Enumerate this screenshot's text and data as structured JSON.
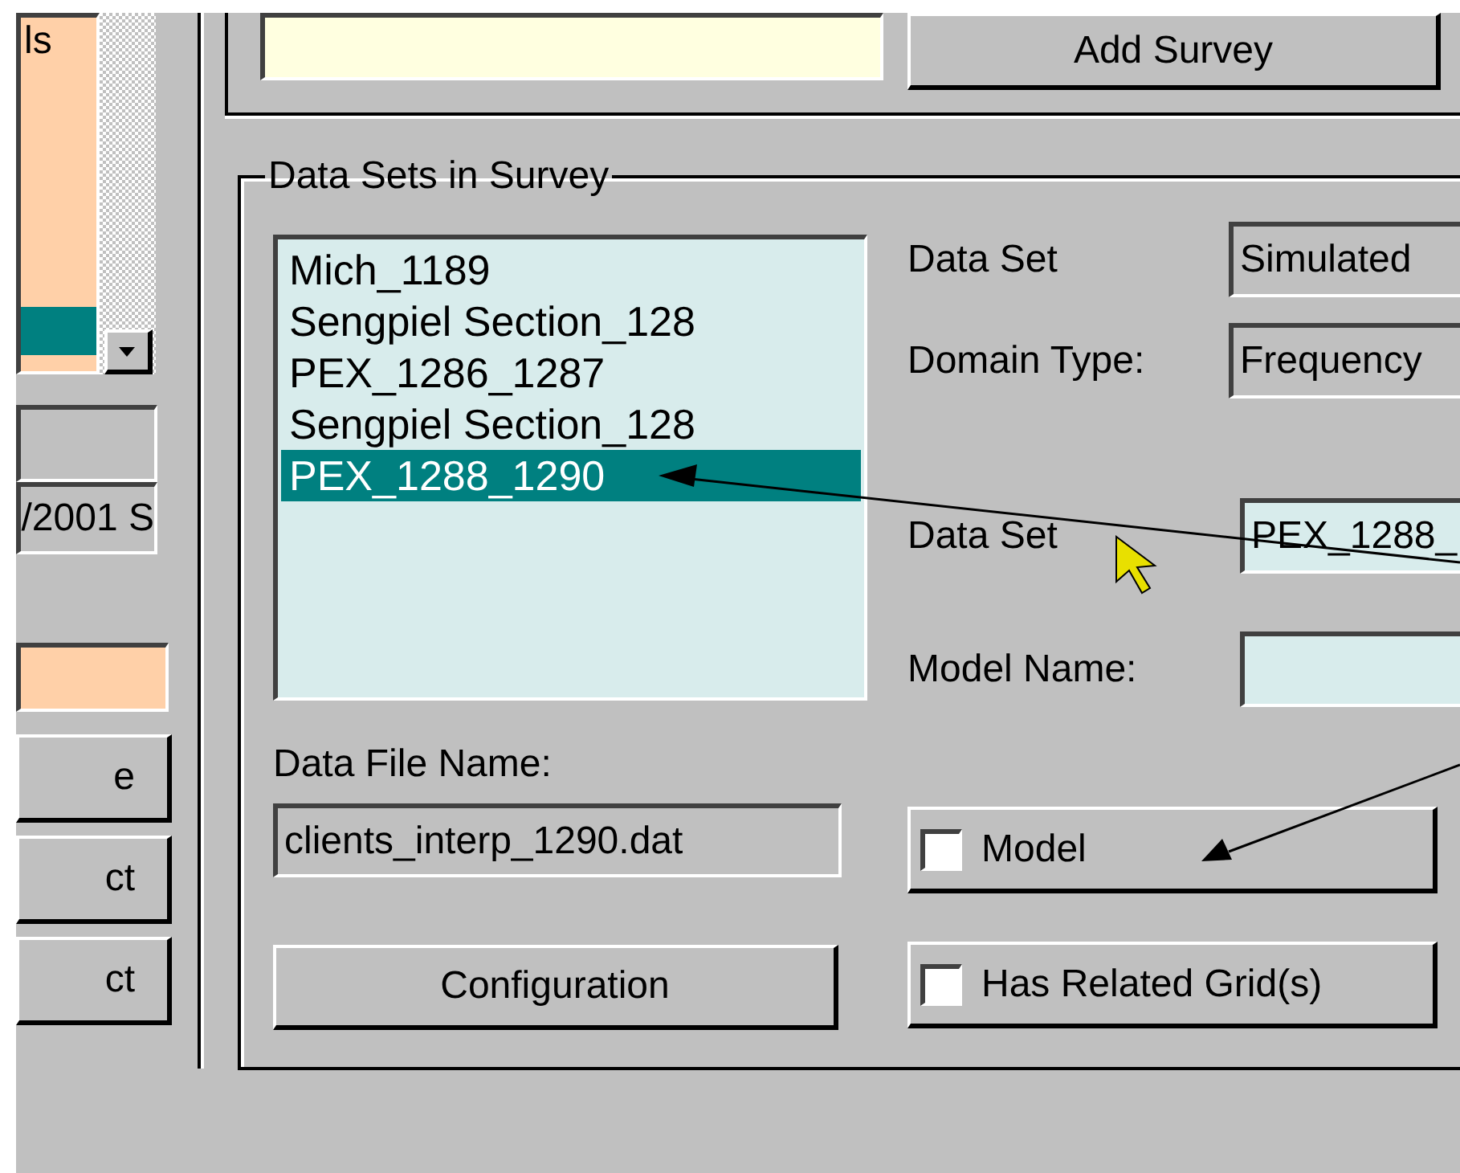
{
  "left_panel": {
    "list_items": [
      {
        "label": "ls",
        "selected": false
      },
      {
        "selected": true
      }
    ],
    "date_field": "/2001 S",
    "buttons": [
      "e",
      "ct",
      "ct"
    ]
  },
  "add_survey_button": "Add Survey",
  "data_sets_group": {
    "title": "Data Sets in Survey",
    "data_sets": [
      {
        "label": "Mich_1189",
        "selected": false
      },
      {
        "label": "Sengpiel Section_128",
        "selected": false
      },
      {
        "label": "PEX_1286_1287",
        "selected": false
      },
      {
        "label": "Sengpiel Section_128",
        "selected": false
      },
      {
        "label": "PEX_1288_1290",
        "selected": true
      }
    ],
    "data_set_type": {
      "label": "Data Set",
      "value": "Simulated"
    },
    "domain_type": {
      "label": "Domain Type:",
      "value": "Frequency"
    },
    "data_set": {
      "label": "Data Set",
      "value": "PEX_1288_"
    },
    "model_name": {
      "label": "Model Name:"
    },
    "data_file": {
      "label": "Data File Name:",
      "value": "clients_interp_1290.dat"
    },
    "configuration_button": "Configuration",
    "checkboxes": [
      {
        "label": "Model",
        "checked": false
      },
      {
        "label": "Has Related Grid(s)",
        "checked": false
      }
    ]
  }
}
